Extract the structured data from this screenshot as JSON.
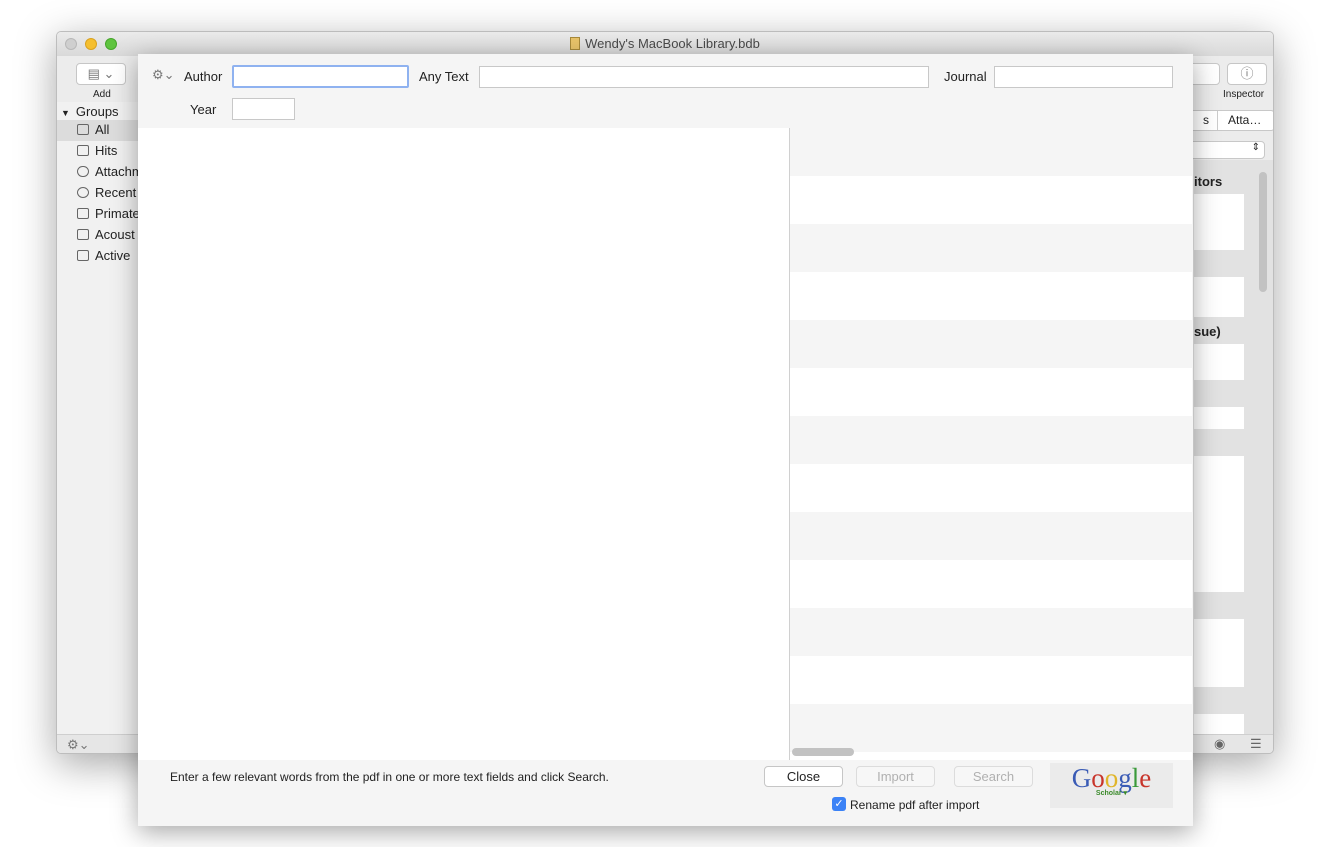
{
  "window": {
    "title": "Wendy's MacBook Library.bdb"
  },
  "toolbar": {
    "add_label": "Add",
    "inspector_label": "Inspector"
  },
  "sidebar": {
    "header": "Groups",
    "items": [
      {
        "label": "All",
        "icon": "library-icon"
      },
      {
        "label": "Hits",
        "icon": "checkbox-icon"
      },
      {
        "label": "Attachments",
        "icon": "paperclip-icon"
      },
      {
        "label": "Recent",
        "icon": "clock-icon"
      },
      {
        "label": "Primate",
        "icon": "folder-icon"
      },
      {
        "label": "Acoust",
        "icon": "folder-icon"
      },
      {
        "label": "Active",
        "icon": "folder-icon"
      }
    ]
  },
  "inspector": {
    "tabs": [
      "s",
      "Atta…"
    ],
    "heading1": "itors",
    "heading2": "sue)"
  },
  "sheet": {
    "author_label": "Author",
    "author_value": "",
    "anytext_label": "Any Text",
    "anytext_value": "",
    "journal_label": "Journal",
    "journal_value": "",
    "year_label": "Year",
    "year_value": "",
    "hint": "Enter a few relevant words from the pdf in one or more text fields and click Search.",
    "close_label": "Close",
    "import_label": "Import",
    "search_label": "Search",
    "rename_label": "Rename pdf after import",
    "rename_checked": true,
    "provider_logo": "Google Scholar"
  },
  "colors": {
    "accent": "#3b82f6",
    "focus_ring": "#8fb2f0"
  }
}
